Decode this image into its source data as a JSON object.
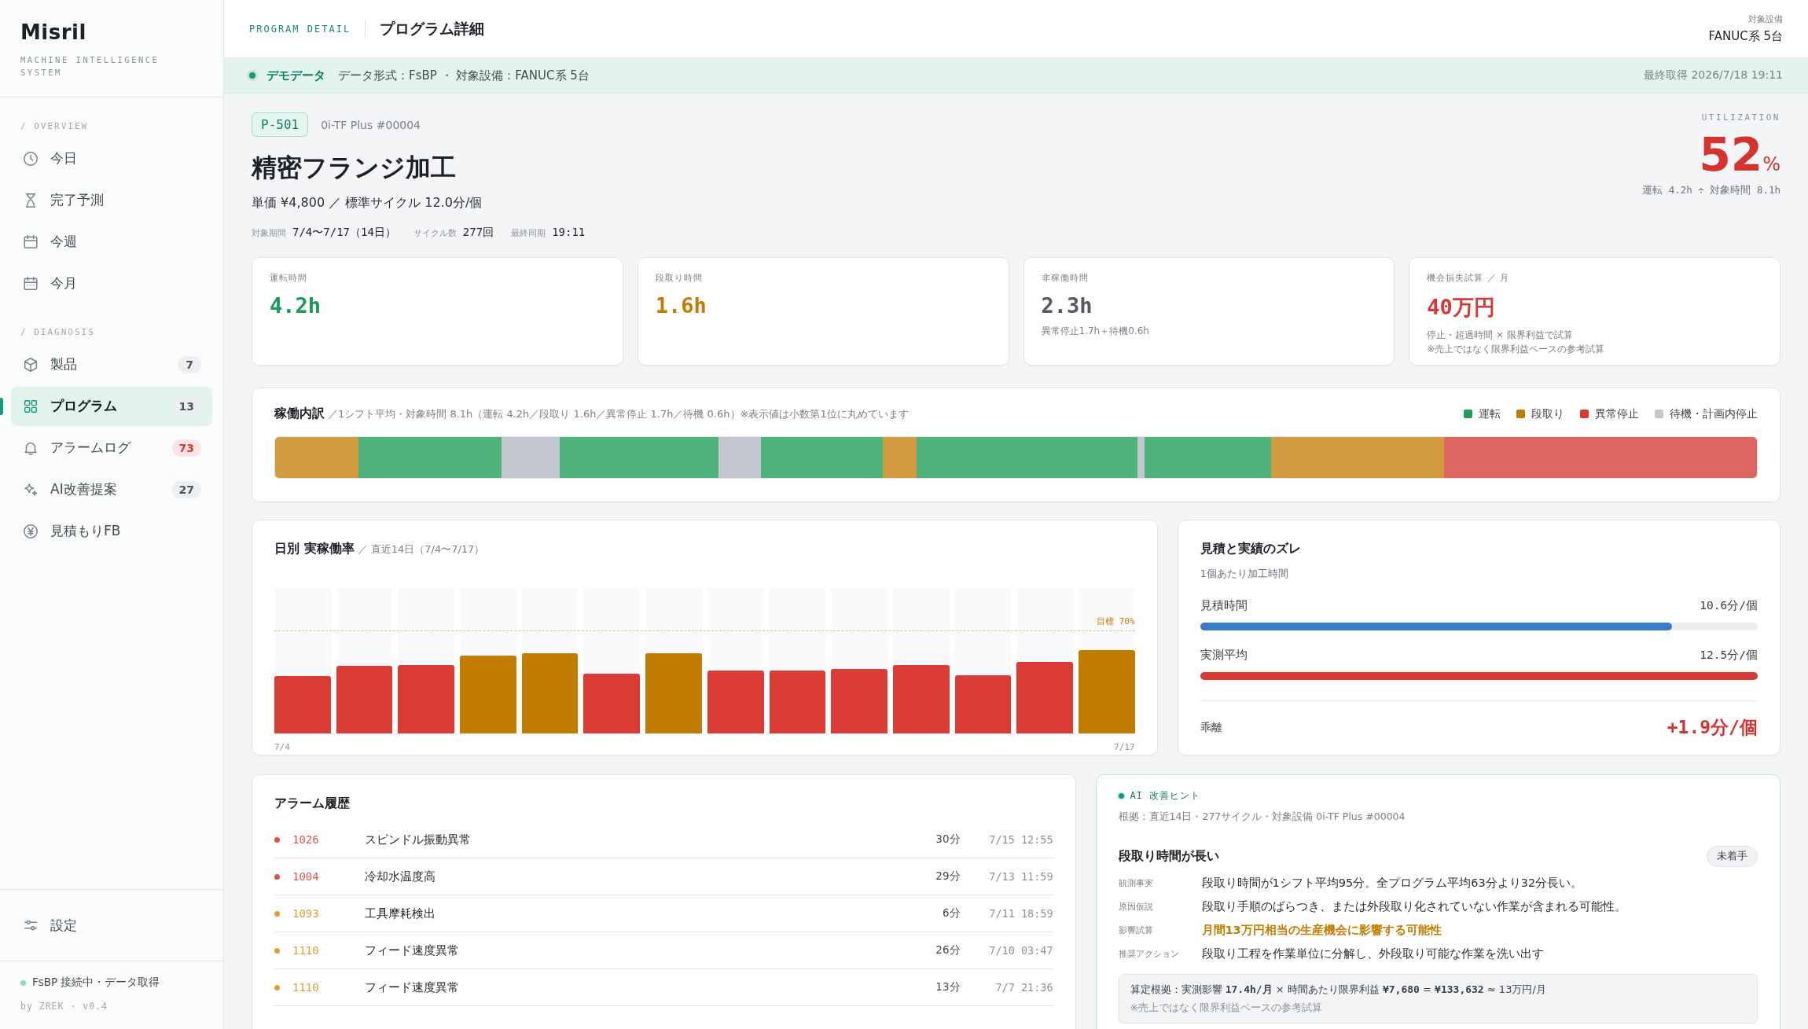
{
  "sidebar": {
    "brand": "Misril",
    "tagline": "MACHINE INTELLIGENCE SYSTEM",
    "sections": [
      {
        "heading": "/ OVERVIEW",
        "items": [
          {
            "label": "今日",
            "kind": "clock",
            "selected": false
          },
          {
            "label": "完了予測",
            "kind": "hourglass",
            "selected": false
          },
          {
            "label": "今週",
            "kind": "calendar",
            "selected": false
          },
          {
            "label": "今月",
            "kind": "calendar-grid",
            "selected": false
          }
        ]
      },
      {
        "heading": "/ DIAGNOSIS",
        "items": [
          {
            "label": "製品",
            "kind": "cube",
            "selected": false,
            "badge": "7",
            "alert": false
          },
          {
            "label": "プログラム",
            "kind": "grid",
            "selected": true,
            "badge": "13",
            "alert": false
          },
          {
            "label": "アラームログ",
            "kind": "bell",
            "selected": false,
            "badge": "73",
            "alert": true
          },
          {
            "label": "AI改善提案",
            "kind": "sparkle",
            "selected": false,
            "badge": "27",
            "alert": false
          },
          {
            "label": "見積もりFB",
            "kind": "yen",
            "selected": false
          }
        ]
      }
    ],
    "settings": "設定",
    "status": "FsBP 接続中・データ取得",
    "version": "by ZREK · v0.4"
  },
  "header": {
    "section": "PROGRAM DETAIL",
    "title": "プログラム詳細",
    "equipment_label": "対象設備",
    "equipment": "FANUC系 5台"
  },
  "banner": {
    "label": "デモデータ",
    "text": "データ形式：FsBP ・ 対象設備：FANUC系 5台",
    "fetched": "最終取得 2026/7/18 19:11"
  },
  "program": {
    "code": "P-501",
    "machine": "0i-TF Plus #00004",
    "name": "精密フランジ加工",
    "price": "単価 ¥4,800 ／ 標準サイクル 12.0分/個",
    "meta": [
      {
        "label": "対象期間",
        "value": "7/4〜7/17（14日）"
      },
      {
        "label": "サイクル数",
        "value": "277回"
      },
      {
        "label": "最終同期",
        "value": "19:11"
      }
    ]
  },
  "utilization": {
    "label": "UTILIZATION",
    "value": "52",
    "unit": "%",
    "note": "運転 4.2h ÷ 対象時間 8.1h"
  },
  "kpis": [
    {
      "label": "運転時間",
      "value": "4.2h",
      "color": "#1a9a55"
    },
    {
      "label": "段取り時間",
      "value": "1.6h",
      "color": "#c27c00"
    },
    {
      "label": "非稼働時間",
      "value": "2.3h",
      "color": "#555a62",
      "notes": [
        "異常停止1.7h＋待機0.6h"
      ]
    },
    {
      "label": "機会損失試算 ／ 月",
      "value": "40万円",
      "color": "#d63a34",
      "notes": [
        "停止・超過時間 × 限界利益で試算",
        "※売上ではなく限界利益ベースの参考試算"
      ]
    }
  ],
  "breakdown": {
    "title": "稼働内訳",
    "subtitle": "／1シフト平均・対象時間 8.1h（運転 4.2h／段取り 1.6h／異常停止 1.7h／待機 0.6h）※表示値は小数第1位に丸めています",
    "legend": [
      {
        "kind": "run",
        "label": "運転",
        "color": "#1e9d57"
      },
      {
        "kind": "setup",
        "label": "段取り",
        "color": "#c27c00"
      },
      {
        "kind": "alarm",
        "label": "異常停止",
        "color": "#d63a34"
      },
      {
        "kind": "idle",
        "label": "待機・計画内停止",
        "color": "#c3c8d0"
      }
    ],
    "segments": [
      {
        "kind": "setup"
      },
      {
        "kind": "run"
      },
      {
        "kind": "idle"
      },
      {
        "kind": "run"
      },
      {
        "kind": "idle"
      },
      {
        "kind": "run"
      },
      {
        "kind": "setup"
      },
      {
        "kind": "run"
      },
      {
        "kind": "idle"
      },
      {
        "kind": "run"
      },
      {
        "kind": "setup"
      },
      {
        "kind": "alarm"
      }
    ]
  },
  "daily": {
    "title": "日別 実稼働率",
    "subtitle": "／ 直近14日（7/4〜7/17）",
    "target": {
      "label": "目標 70%"
    },
    "x_start": "7/4",
    "x_end": "7/17",
    "bars": [
      {
        "level": 0.39,
        "color": "#db3b35"
      },
      {
        "level": 0.46,
        "color": "#db3b35"
      },
      {
        "level": 0.47,
        "color": "#db3b35"
      },
      {
        "level": 0.53,
        "color": "#c27c00"
      },
      {
        "level": 0.55,
        "color": "#c27c00"
      },
      {
        "level": 0.41,
        "color": "#db3b35"
      },
      {
        "level": 0.55,
        "color": "#c27c00"
      },
      {
        "level": 0.43,
        "color": "#db3b35"
      },
      {
        "level": 0.43,
        "color": "#db3b35"
      },
      {
        "level": 0.44,
        "color": "#db3b35"
      },
      {
        "level": 0.47,
        "color": "#db3b35"
      },
      {
        "level": 0.4,
        "color": "#db3b35"
      },
      {
        "level": 0.49,
        "color": "#db3b35"
      },
      {
        "level": 0.57,
        "color": "#c27c00"
      }
    ]
  },
  "estimate": {
    "title": "見積と実績のズレ",
    "subtitle": "1個あたり加工時間",
    "rows": [
      {
        "label": "見積時間",
        "value": "10.6分/個",
        "level": 0.847,
        "color": "#3b7bc8"
      },
      {
        "label": "実測平均",
        "value": "12.5分/個",
        "level": 1.0,
        "color": "#d63a34"
      }
    ],
    "diff_label": "乖離",
    "diff": "+1.9分/個"
  },
  "alarms": {
    "title": "アラーム履歴",
    "rows": [
      {
        "code": "1026",
        "name": "スピンドル振動異常",
        "duration": "30分",
        "time": "7/15 12:55",
        "color": "#e0524d"
      },
      {
        "code": "1004",
        "name": "冷却水温度高",
        "duration": "29分",
        "time": "7/13 11:59",
        "color": "#e0524d"
      },
      {
        "code": "1093",
        "name": "工具摩耗検出",
        "duration": "6分",
        "time": "7/11 18:59",
        "color": "#d9a13a"
      },
      {
        "code": "1110",
        "name": "フィード速度異常",
        "duration": "26分",
        "time": "7/10 03:47",
        "color": "#d9a13a"
      },
      {
        "code": "1110",
        "name": "フィード速度異常",
        "duration": "13分",
        "time": "7/7 21:36",
        "color": "#d9a13a"
      }
    ]
  },
  "ai": {
    "label": "AI 改善ヒント",
    "basis": "根拠：直近14日・277サイクル・対象設備 0i-TF Plus #00004",
    "title": "段取り時間が長い",
    "status": "未着手",
    "facts": [
      {
        "label": "観測事実",
        "text": "段取り時間が1シフト平均95分。全プログラム平均63分より32分長い。",
        "kind": "plain"
      },
      {
        "label": "原因仮説",
        "text": "段取り手順のばらつき、または外段取り化されていない作業が含まれる可能性。",
        "kind": "plain"
      },
      {
        "label": "影響試算",
        "text": "月間13万円相当の生産機会に影響する可能性",
        "kind": "highlight"
      },
      {
        "label": "推奨アクション",
        "text": "段取り工程を作業単位に分解し、外段取り可能な作業を洗い出す",
        "kind": "plain"
      }
    ],
    "calc": "算定根拠：実測影響 **17.4h/月** × 時間あたり限界利益 **¥7,680** = **¥133,632** ≈ 13万円/月",
    "calc_note": "※売上ではなく限界利益ベースの参考試算"
  }
}
